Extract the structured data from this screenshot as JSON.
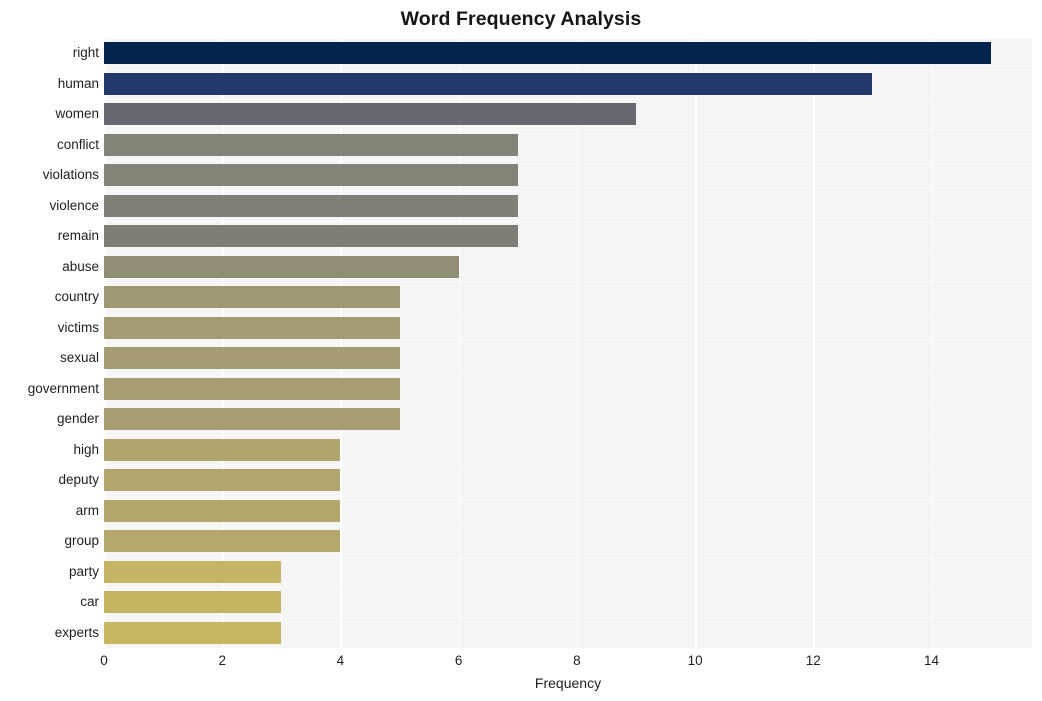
{
  "chart_data": {
    "type": "bar",
    "orientation": "horizontal",
    "title": "Word Frequency Analysis",
    "xlabel": "Frequency",
    "ylabel": "",
    "categories": [
      "right",
      "human",
      "women",
      "conflict",
      "violations",
      "violence",
      "remain",
      "abuse",
      "country",
      "victims",
      "sexual",
      "government",
      "gender",
      "high",
      "deputy",
      "arm",
      "group",
      "party",
      "car",
      "experts"
    ],
    "values": [
      15,
      13,
      9,
      7,
      7,
      7,
      7,
      6,
      5,
      5,
      5,
      5,
      5,
      4,
      4,
      4,
      4,
      3,
      3,
      3
    ],
    "xticks": [
      0,
      2,
      4,
      6,
      8,
      10,
      12,
      14
    ],
    "xtick_labels": [
      "0",
      "2",
      "4",
      "6",
      "8",
      "10",
      "12",
      "14"
    ],
    "xlim": [
      0,
      15.7
    ],
    "grid": true,
    "legend": null,
    "bar_colors": [
      "#04234d",
      "#23386b",
      "#656870",
      "#848378",
      "#858278",
      "#827f76",
      "#807d74",
      "#918d74",
      "#a09873",
      "#a49b73",
      "#a59c73",
      "#a69d73",
      "#a79e72",
      "#b1a56f",
      "#b2a66f",
      "#b3a76e",
      "#b4a86e",
      "#c4b464",
      "#c5b563",
      "#c6b662"
    ],
    "plot_background": "#f5f5f6",
    "gridline_color": "#ffffff",
    "figure_background": "#ffffff",
    "text_color": "#1f1f1f"
  }
}
